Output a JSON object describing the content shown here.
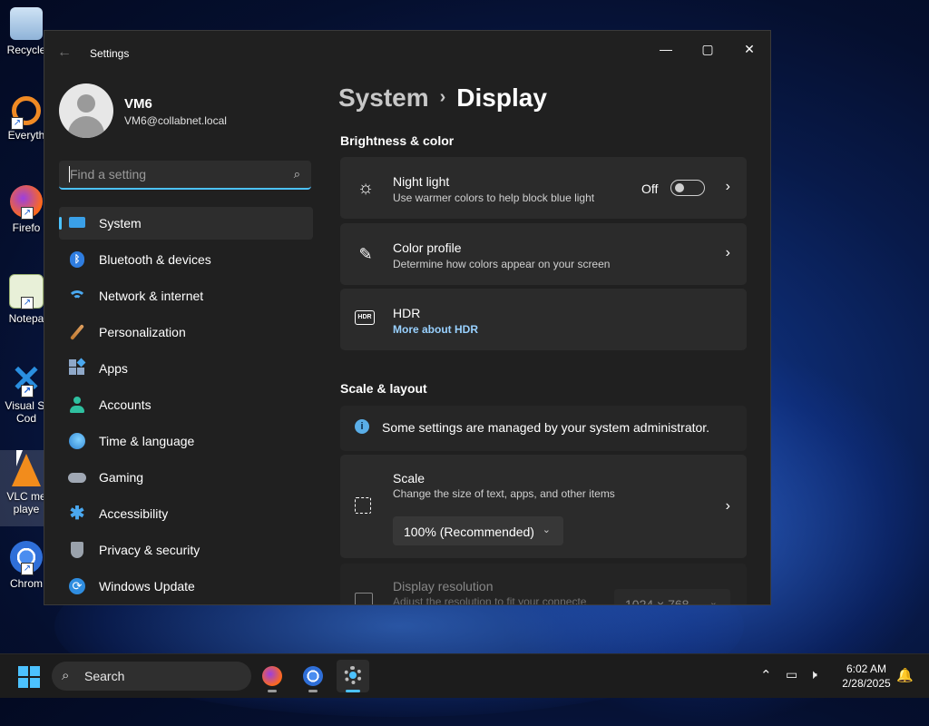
{
  "desktop": {
    "icons": [
      {
        "label": "Recycle",
        "icon": "recycle-bin-icon"
      },
      {
        "label": "Everyth",
        "icon": "everything-search-icon"
      },
      {
        "label": "Firefo",
        "icon": "firefox-icon"
      },
      {
        "label": "Notepa",
        "icon": "notepad-icon"
      },
      {
        "label": "Visual St\nCod",
        "icon": "vscode-icon"
      },
      {
        "label": "VLC me\nplaye",
        "icon": "vlc-icon"
      },
      {
        "label": "Chrom",
        "icon": "chrome-icon"
      }
    ]
  },
  "window": {
    "title": "Settings",
    "back_icon": "back-arrow-icon",
    "minimize": "—",
    "maximize": "▢",
    "close": "✕"
  },
  "profile": {
    "name": "VM6",
    "email": "VM6@collabnet.local"
  },
  "search": {
    "placeholder": "Find a setting",
    "icon": "search-icon"
  },
  "nav": {
    "items": [
      {
        "label": "System",
        "icon": "monitor-icon",
        "active": true
      },
      {
        "label": "Bluetooth & devices",
        "icon": "bluetooth-icon"
      },
      {
        "label": "Network & internet",
        "icon": "wifi-icon"
      },
      {
        "label": "Personalization",
        "icon": "brush-icon"
      },
      {
        "label": "Apps",
        "icon": "apps-icon"
      },
      {
        "label": "Accounts",
        "icon": "person-icon"
      },
      {
        "label": "Time & language",
        "icon": "globe-clock-icon"
      },
      {
        "label": "Gaming",
        "icon": "gamepad-icon"
      },
      {
        "label": "Accessibility",
        "icon": "accessibility-icon"
      },
      {
        "label": "Privacy & security",
        "icon": "shield-icon"
      },
      {
        "label": "Windows Update",
        "icon": "update-icon"
      }
    ]
  },
  "content": {
    "breadcrumb": {
      "parent": "System",
      "separator": "›",
      "current": "Display"
    },
    "brightness_section": "Brightness & color",
    "night_light": {
      "title": "Night light",
      "subtitle": "Use warmer colors to help block blue light",
      "state_label": "Off",
      "toggle_on": false
    },
    "color_profile": {
      "title": "Color profile",
      "subtitle": "Determine how colors appear on your screen"
    },
    "hdr": {
      "title": "HDR",
      "link": "More about HDR"
    },
    "scale_section": "Scale & layout",
    "admin_notice": "Some settings are managed by your system administrator.",
    "scale": {
      "title": "Scale",
      "subtitle": "Change the size of text, apps, and other items",
      "value": "100% (Recommended)"
    },
    "resolution": {
      "title": "Display resolution",
      "subtitle": "Adjust the resolution to fit your connecte",
      "value": "1024 × 768"
    }
  },
  "taskbar": {
    "search_label": "Search",
    "apps": [
      "firefox-icon",
      "chrome-icon",
      "settings-gear-icon"
    ],
    "time": "6:02 AM",
    "date": "2/28/2025"
  },
  "colors": {
    "accent": "#4cc2ff",
    "window_bg": "#202020",
    "card_bg": "#2b2b2b"
  }
}
